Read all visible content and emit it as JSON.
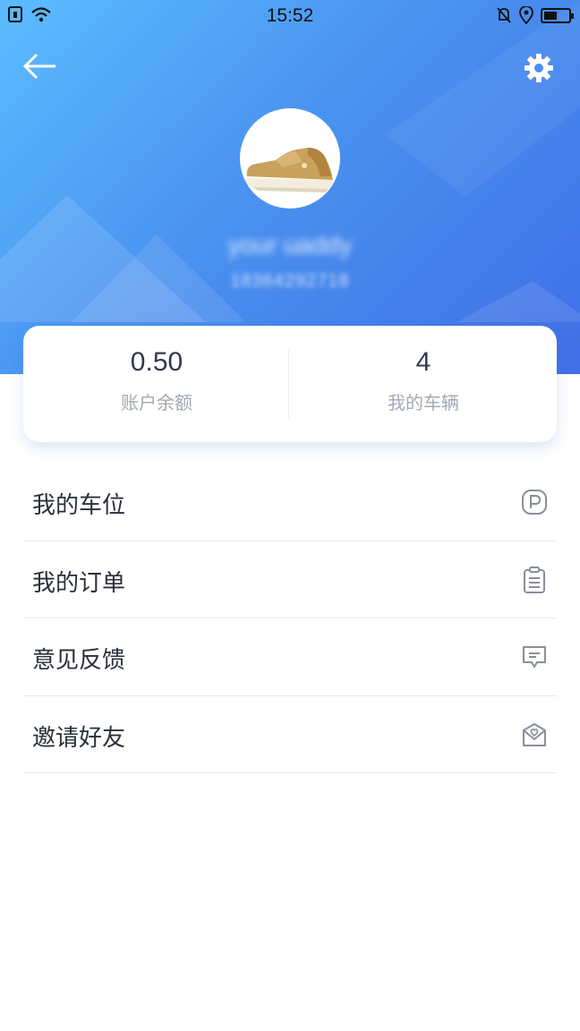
{
  "status_bar": {
    "time": "15:52"
  },
  "header": {
    "back_icon": "arrow-left-icon",
    "settings_icon": "gear-icon",
    "avatar": "sneaker-image",
    "username": "your uaddy",
    "phone": "18364292718"
  },
  "stats": [
    {
      "value": "0.50",
      "label": "账户余额"
    },
    {
      "value": "4",
      "label": "我的车辆"
    }
  ],
  "menu": [
    {
      "label": "我的车位",
      "icon": "parking-icon"
    },
    {
      "label": "我的订单",
      "icon": "clipboard-icon"
    },
    {
      "label": "意见反馈",
      "icon": "message-icon"
    },
    {
      "label": "邀请好友",
      "icon": "invite-envelope-icon"
    }
  ],
  "colors": {
    "gradient_start": "#5cbcff",
    "gradient_end": "#3f6fe6",
    "text_primary": "#2b2f3a",
    "text_secondary": "#a4a8b3",
    "icon_gray": "#8a8f99"
  }
}
